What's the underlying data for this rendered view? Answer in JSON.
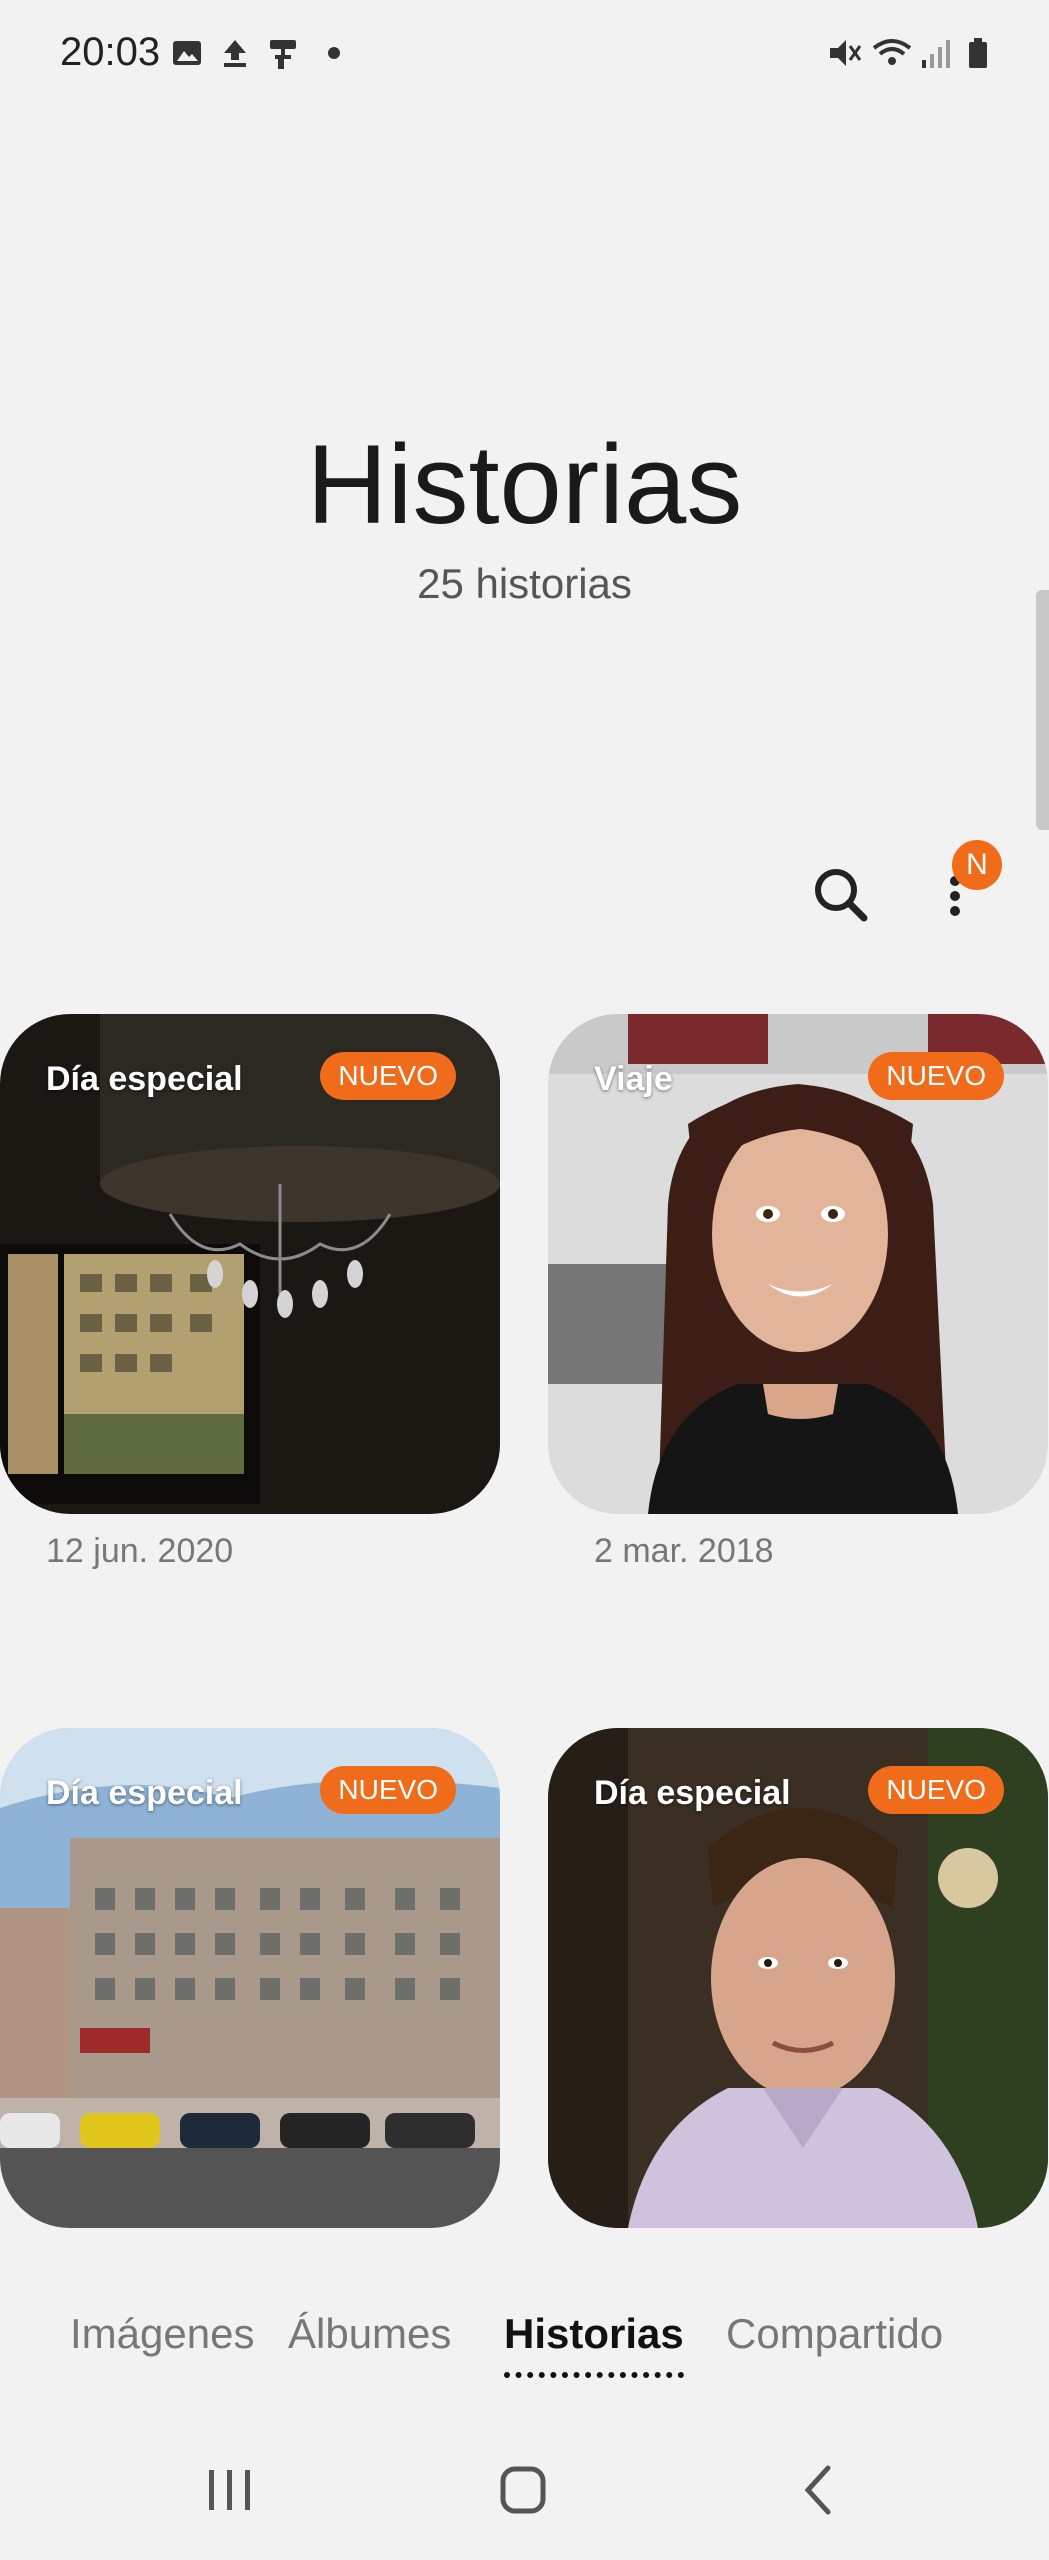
{
  "status_bar": {
    "time": "20:03"
  },
  "header": {
    "title": "Historias",
    "subtitle": "25 historias"
  },
  "actions": {
    "badge": "N"
  },
  "stories": [
    {
      "label": "Día especial",
      "badge": "NUEVO",
      "date": "12 jun. 2020"
    },
    {
      "label": "Viaje",
      "badge": "NUEVO",
      "date": "2 mar. 2018"
    },
    {
      "label": "Día especial",
      "badge": "NUEVO"
    },
    {
      "label": "Día especial",
      "badge": "NUEVO"
    }
  ],
  "tabs": [
    {
      "label": "Imágenes"
    },
    {
      "label": "Álbumes"
    },
    {
      "label": "Historias",
      "active": true
    },
    {
      "label": "Compartido"
    }
  ],
  "colors": {
    "accent": "#f06c1a",
    "background": "#f2f2f2"
  }
}
